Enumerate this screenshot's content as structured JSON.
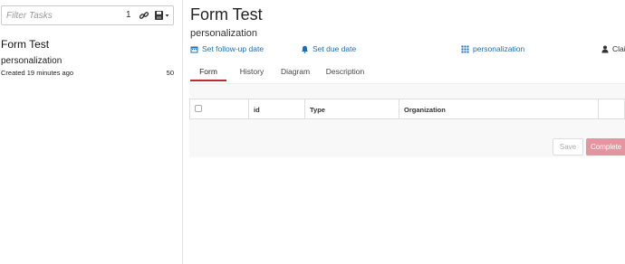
{
  "task_list": {
    "filter": {
      "placeholder": "Filter Tasks",
      "value": "",
      "count": "1"
    },
    "icons": [
      "link-icon",
      "save-icon",
      "caret-down-icon"
    ],
    "tasks": [
      {
        "name": "Form Test",
        "process": "personalization",
        "created": "Created 19 minutes ago",
        "priority": "50"
      }
    ]
  },
  "task_detail": {
    "title": "Form Test",
    "subtitle": "personalization",
    "actions": {
      "follow_up": "Set follow-up date",
      "due": "Set due date",
      "group": "personalization",
      "claim": "Clai"
    },
    "tabs": [
      {
        "label": "Form",
        "active": true
      },
      {
        "label": "History",
        "active": false
      },
      {
        "label": "Diagram",
        "active": false
      },
      {
        "label": "Description",
        "active": false
      }
    ],
    "form": {
      "columns": [
        "",
        "id",
        "Type",
        "Organization",
        ""
      ],
      "buttons": {
        "save": "Save",
        "complete": "Complete"
      }
    }
  },
  "colors": {
    "link_blue": "#1c6fb4",
    "active_tab_underline": "#c0293a",
    "complete_button": "#e3969f",
    "form_background": "#f8f8f8"
  }
}
